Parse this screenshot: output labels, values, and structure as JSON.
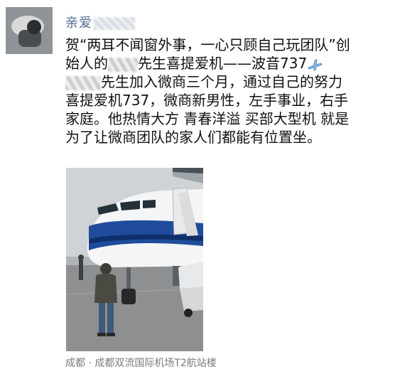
{
  "author": {
    "name_prefix": "亲爱"
  },
  "post": {
    "line1": "贺“两耳不闻窗外事，一心只顾自己玩团队”创",
    "line2_a": "始人的",
    "line2_b": "先生喜提爱机——波音737",
    "line3_b": "先生加入微商三个月，通过自己的努力",
    "line4": "喜提爱机737，微商新男性，左手事业，右手",
    "line5": "家庭。他热情大方 青春洋溢 买部大型机 就是",
    "line6": "为了让微商团队的家人们都能有位置坐。"
  },
  "photo": {
    "subject": "airplane"
  },
  "location": {
    "text": "成都 · 成都双流国际机场T2航站楼"
  },
  "icons": {
    "plane": "airplane-emoji-icon"
  },
  "colors": {
    "name": "#576b95",
    "location": "#7a7a7a",
    "plane_blue": "#1f4d9c"
  }
}
